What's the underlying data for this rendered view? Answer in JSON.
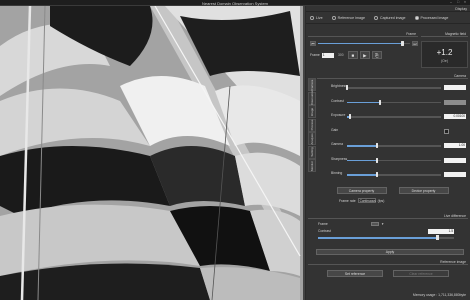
{
  "app": {
    "title": "Nearest Domain Observation System"
  },
  "display": {
    "header": "Display",
    "options": [
      {
        "label": "Live",
        "selected": false
      },
      {
        "label": "Reference image",
        "selected": false
      },
      {
        "label": "Captured image",
        "selected": false
      },
      {
        "label": "Processed image",
        "selected": true
      }
    ]
  },
  "frame": {
    "header": "Frame",
    "frame_label": "Frame",
    "frame_value": "1",
    "frame_total": "300",
    "position_fraction": 0.92
  },
  "magnetic_field": {
    "header": "Magnetic field",
    "value": "+1.2",
    "unit": "(Oe)"
  },
  "side_tabs": [
    "Camera",
    "Observation",
    "Image",
    "Process",
    "Analysis",
    "Setting",
    "Monitor"
  ],
  "camera": {
    "header": "Camera",
    "controls": [
      {
        "name": "Brightness",
        "value": "",
        "fraction": 0.0
      },
      {
        "name": "Contrast",
        "value": "",
        "fraction": 0.35,
        "gray": true
      },
      {
        "name": "Exposure",
        "value": "0.00100",
        "fraction": 0.03
      },
      {
        "name": "Gain",
        "value": "",
        "fraction": 0.0,
        "checkbox": true
      },
      {
        "name": "Gamma",
        "value": "1.00",
        "fraction": 0.32
      },
      {
        "name": "Sharpness",
        "value": "",
        "fraction": 0.32
      },
      {
        "name": "Binning",
        "value": "",
        "fraction": 0.32
      }
    ],
    "camera_property_label": "Camera property",
    "device_property_label": "Device property",
    "frame_rate_label": "Frame rate",
    "frame_rate_value": "Continuous",
    "frame_rate_unit": "(fps)"
  },
  "live_difference": {
    "header": "Live difference",
    "frame_label": "Frame",
    "contrast_label": "Contrast",
    "contrast_value": "1.5",
    "contrast_fraction": 0.88,
    "apply_label": "Apply"
  },
  "reference_image": {
    "header": "Reference image",
    "set_reference_label": "Set reference",
    "clear_reference_label": "Clear reference"
  },
  "status": {
    "memory_usage": "Memory usage : 1,711,336,880byte"
  }
}
